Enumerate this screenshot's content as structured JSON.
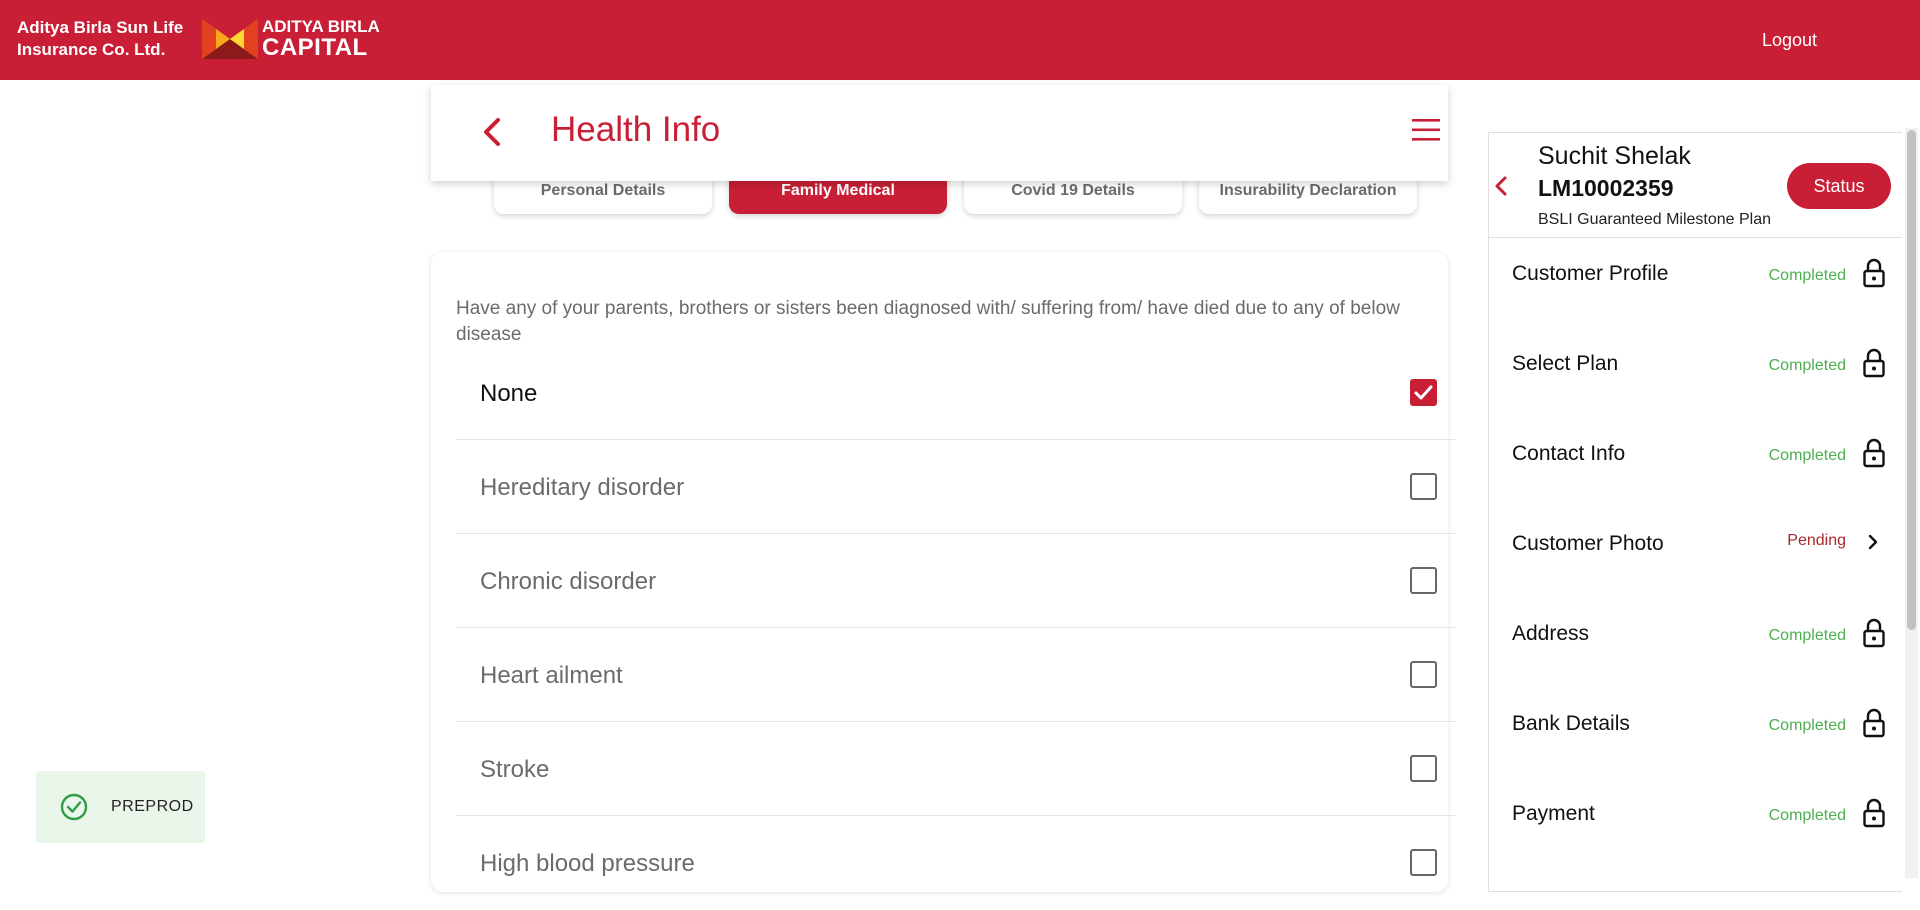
{
  "header": {
    "brand_line1": "Aditya Birla Sun Life",
    "brand_line2": "Insurance Co. Ltd.",
    "logo_line1": "ADITYA BIRLA",
    "logo_line2": "CAPITAL",
    "logout_label": "Logout",
    "bar_color": "#c91f36"
  },
  "page": {
    "title": "Health Info",
    "back_icon": "chevron-left-icon",
    "menu_icon": "hamburger-menu-icon"
  },
  "tabs": [
    {
      "label": "Personal Details",
      "active": false
    },
    {
      "label": "Family Medical",
      "active": true
    },
    {
      "label": "Covid 19 Details",
      "active": false
    },
    {
      "label": "Insurability Declaration",
      "active": false
    }
  ],
  "form": {
    "question": "Have any of your parents, brothers or sisters been diagnosed with/ suffering from/ have died due to any of below disease",
    "options": [
      {
        "label": "None",
        "checked": true
      },
      {
        "label": "Hereditary disorder",
        "checked": false
      },
      {
        "label": "Chronic disorder",
        "checked": false
      },
      {
        "label": "Heart ailment",
        "checked": false
      },
      {
        "label": "Stroke",
        "checked": false
      },
      {
        "label": "High blood pressure",
        "checked": false
      }
    ]
  },
  "env_badge": {
    "label": "PREPROD",
    "icon": "check-circle-icon"
  },
  "sidebar": {
    "customer_name": "Suchit Shelak",
    "customer_id": "LM10002359",
    "plan_name": "BSLI Guaranteed Milestone Plan",
    "status_button": "Status",
    "steps": [
      {
        "label": "Customer Profile",
        "status": "Completed",
        "icon": "lock-icon"
      },
      {
        "label": "Select Plan",
        "status": "Completed",
        "icon": "lock-icon"
      },
      {
        "label": "Contact Info",
        "status": "Completed",
        "icon": "lock-icon"
      },
      {
        "label": "Customer Photo",
        "status": "Pending",
        "icon": "chevron-right-icon"
      },
      {
        "label": "Address",
        "status": "Completed",
        "icon": "lock-icon"
      },
      {
        "label": "Bank Details",
        "status": "Completed",
        "icon": "lock-icon"
      },
      {
        "label": "Payment",
        "status": "Completed",
        "icon": "lock-icon"
      }
    ]
  }
}
